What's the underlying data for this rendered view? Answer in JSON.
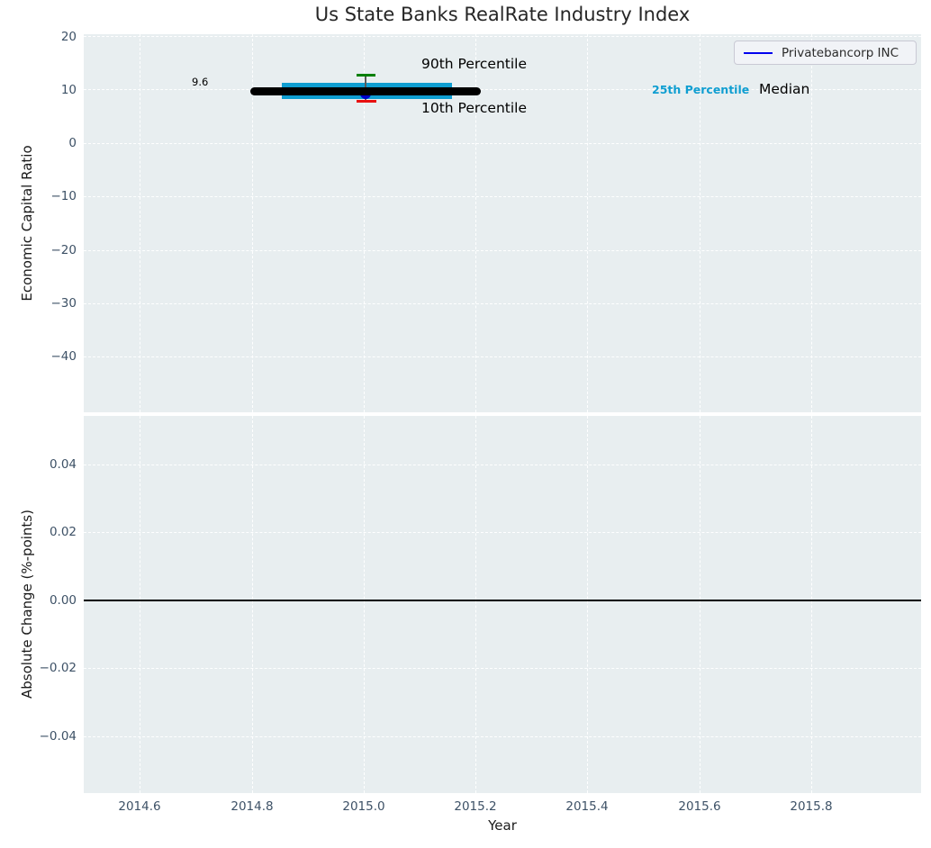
{
  "figure": {
    "title": "Us State Banks RealRate Industry Index"
  },
  "legend": {
    "label": "Privatebancorp INC",
    "line_color": "#0000ee"
  },
  "top_plot": {
    "ylabel": "Economic Capital Ratio",
    "yticklabels": [
      "20",
      "10",
      "0",
      "−10",
      "−20",
      "−30",
      "−40"
    ],
    "annotations": {
      "median_value": "9.6",
      "p90": "90th Percentile",
      "p10": "10th Percentile",
      "p25": "25th Percentile",
      "median": "Median"
    }
  },
  "bottom_plot": {
    "ylabel": "Absolute Change (%-points)",
    "yticklabels": [
      "0.04",
      "0.02",
      "0.00",
      "−0.02",
      "−0.04"
    ]
  },
  "x_axis": {
    "label": "Year",
    "ticklabels": [
      "2014.6",
      "2014.8",
      "2015.0",
      "2015.2",
      "2015.4",
      "2015.6",
      "2015.8"
    ]
  },
  "colors": {
    "axes_bg": "#e8eef0",
    "grid": "#ffffff",
    "tick_label": "#3d5166",
    "percentile_band": "#0f9ed1",
    "median_line": "#000000",
    "company_marker": "#0000cc",
    "p90_marker": "#008000",
    "p10_marker": "#e81010"
  },
  "chart_data": [
    {
      "type": "line",
      "title": "Us State Banks RealRate Industry Index",
      "xlabel": "Year",
      "ylabel": "Economic Capital Ratio",
      "xlim": [
        2014.5,
        2016.0
      ],
      "ylim": [
        -51,
        20
      ],
      "xticks": [
        2014.6,
        2014.8,
        2015.0,
        2015.2,
        2015.4,
        2015.6,
        2015.8
      ],
      "yticks": [
        20,
        10,
        0,
        -10,
        -20,
        -30,
        -40
      ],
      "grid": true,
      "legend_position": "upper right",
      "series": [
        {
          "name": "Privatebancorp INC",
          "x": [
            2015.0
          ],
          "values": [
            9.2
          ],
          "color": "#0000cc",
          "marker": "circle"
        }
      ],
      "percentile_summary": {
        "x": 2015.0,
        "p10": 7.7,
        "p25": 8.2,
        "median": 9.6,
        "p75": 11.2,
        "p90": 12.6,
        "median_x_span": [
          2014.8,
          2015.2
        ],
        "box_x_span": [
          2014.85,
          2015.15
        ]
      },
      "annotations": [
        {
          "text": "9.6",
          "x": 2014.71,
          "y": 11.0
        },
        {
          "text": "90th Percentile",
          "x": 2015.21,
          "y": 13.5
        },
        {
          "text": "10th Percentile",
          "x": 2015.21,
          "y": 5.5
        },
        {
          "text": "25th Percentile",
          "x": 2015.52,
          "y": 9.6
        },
        {
          "text": "Median",
          "x": 2015.71,
          "y": 9.6
        }
      ]
    },
    {
      "type": "line",
      "xlabel": "Year",
      "ylabel": "Absolute Change (%-points)",
      "xlim": [
        2014.5,
        2016.0
      ],
      "ylim": [
        -0.055,
        0.055
      ],
      "xticks": [
        2014.6,
        2014.8,
        2015.0,
        2015.2,
        2015.4,
        2015.6,
        2015.8
      ],
      "yticks": [
        0.04,
        0.02,
        0.0,
        -0.02,
        -0.04
      ],
      "grid": true,
      "series": [],
      "zero_line": 0.0
    }
  ]
}
